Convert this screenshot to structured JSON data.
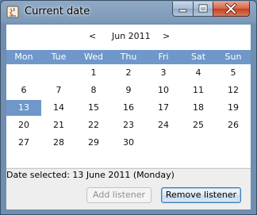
{
  "window": {
    "title": "Current date"
  },
  "calendar": {
    "prev_label": "<",
    "month_label": "Jun 2011",
    "next_label": ">",
    "weekdays": [
      "Mon",
      "Tue",
      "Wed",
      "Thu",
      "Fri",
      "Sat",
      "Sun"
    ],
    "weeks": [
      [
        "",
        "",
        "1",
        "2",
        "3",
        "4",
        "5"
      ],
      [
        "6",
        "7",
        "8",
        "9",
        "10",
        "11",
        "12"
      ],
      [
        "13",
        "14",
        "15",
        "16",
        "17",
        "18",
        "19"
      ],
      [
        "20",
        "21",
        "22",
        "23",
        "24",
        "25",
        "26"
      ],
      [
        "27",
        "28",
        "29",
        "30",
        "",
        "",
        ""
      ]
    ],
    "selected_day": "13"
  },
  "status": {
    "text": "Date selected: 13 June 2011 (Monday)"
  },
  "buttons": {
    "add_listener": "Add listener",
    "remove_listener": "Remove listener"
  },
  "colors": {
    "header_blue": "#6f97c9",
    "selected_blue": "#6f97c9"
  }
}
